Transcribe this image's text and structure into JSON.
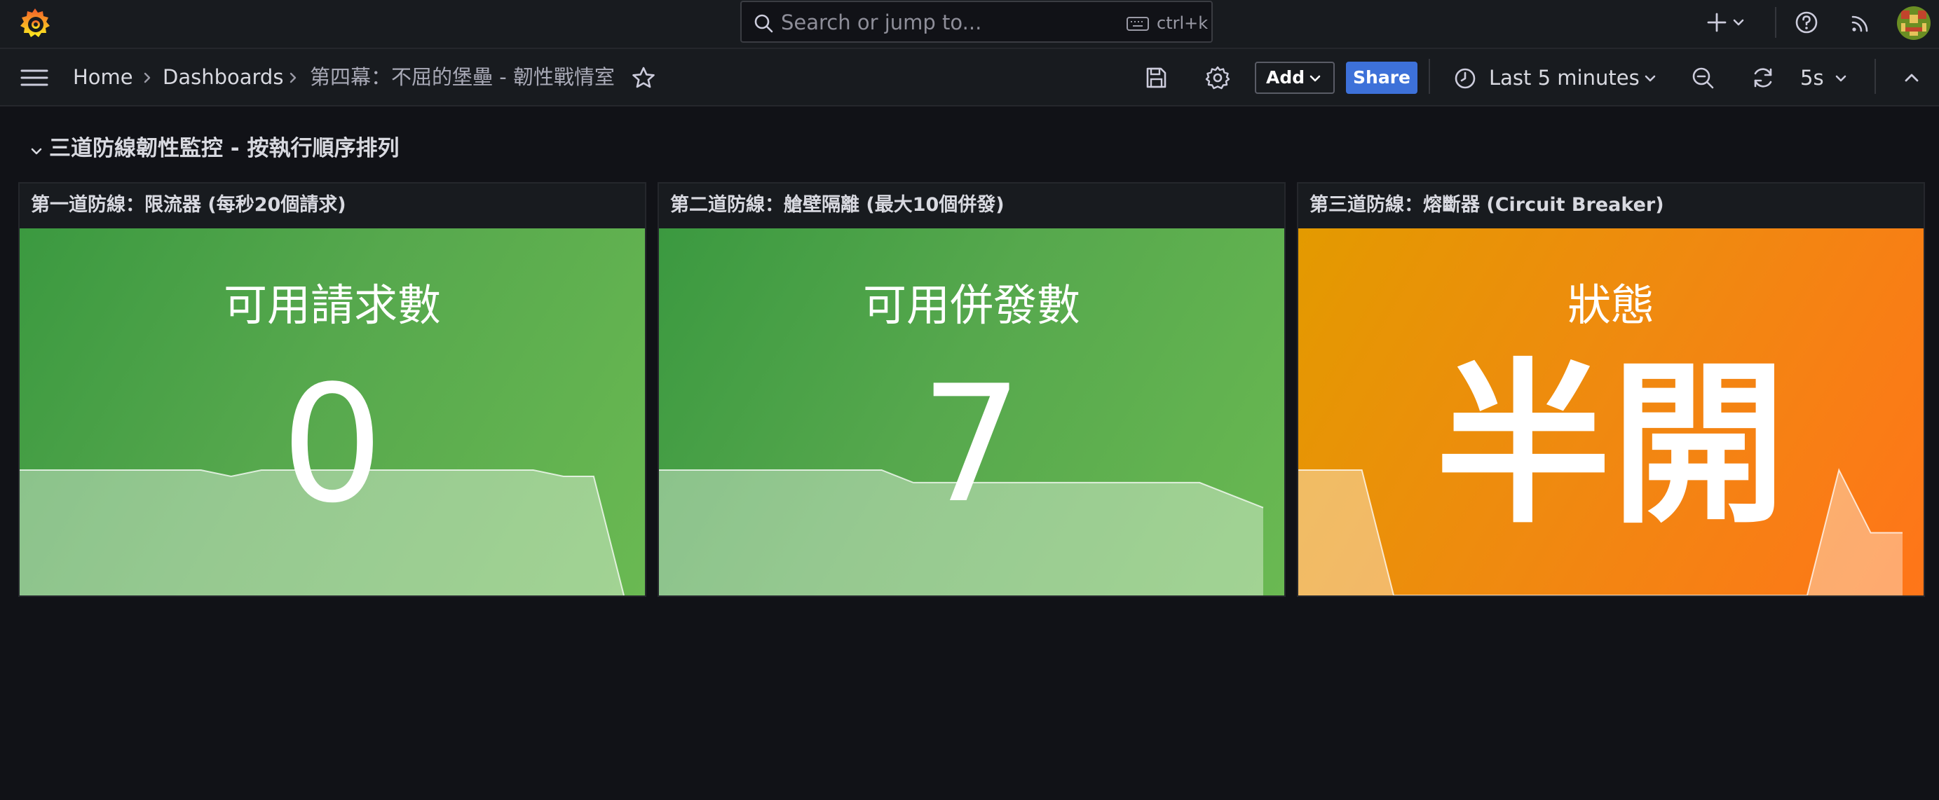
{
  "topbar": {
    "search_placeholder": "Search or jump to...",
    "search_shortcut": "ctrl+k"
  },
  "breadcrumb": {
    "home": "Home",
    "dashboards": "Dashboards",
    "current": "第四幕：不屈的堡壘 - 韌性戰情室"
  },
  "toolbar": {
    "add_label": "Add",
    "share_label": "Share",
    "time_range": "Last 5 minutes",
    "refresh_interval": "5s"
  },
  "row": {
    "title": "三道防線韌性監控 - 按執行順序排列"
  },
  "panels": [
    {
      "title": "第一道防線：限流器 (每秒20個請求)",
      "label": "可用請求數",
      "value": "0",
      "color": "#56a64b",
      "sparkline": [
        20,
        20,
        20,
        20,
        20,
        20,
        20,
        19,
        20,
        20,
        20,
        20,
        20,
        20,
        20,
        20,
        20,
        20,
        19,
        19,
        0
      ]
    },
    {
      "title": "第二道防線：艙壁隔離 (最大10個併發)",
      "label": "可用併發數",
      "value": "7",
      "color": "#56a64b",
      "sparkline": [
        10,
        10,
        10,
        10,
        10,
        10,
        10,
        10,
        9,
        9,
        9,
        9,
        9,
        9,
        9,
        9,
        9,
        9,
        8,
        7
      ]
    },
    {
      "title": "第三道防線：熔斷器 (Circuit Breaker)",
      "label": "狀態",
      "value": "半開",
      "color": "#ff780a",
      "sparkline": [
        1,
        1,
        1,
        0,
        0,
        0,
        0,
        0,
        0,
        0,
        0,
        0,
        0,
        0,
        0,
        0,
        0,
        1,
        0.5,
        0.5
      ]
    }
  ]
}
